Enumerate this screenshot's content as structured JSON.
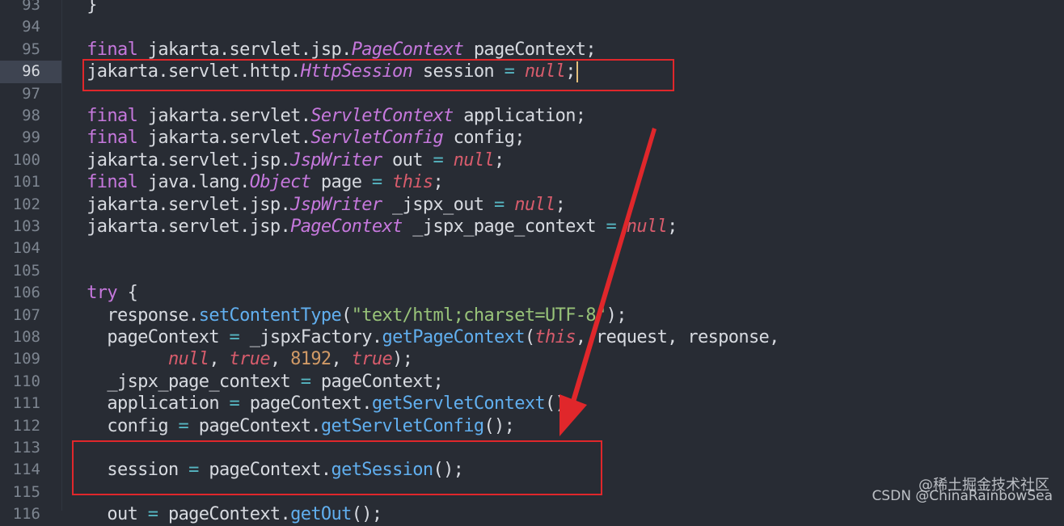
{
  "editor": {
    "active_line": "96",
    "line_numbers": [
      "93",
      "94",
      "95",
      "96",
      "97",
      "98",
      "99",
      "100",
      "101",
      "102",
      "103",
      "104",
      "105",
      "106",
      "107",
      "108",
      "109",
      "110",
      "111",
      "112",
      "113",
      "114",
      "115",
      "116"
    ],
    "lines": [
      [
        {
          "t": "  }",
          "c": "pl"
        }
      ],
      [],
      [
        {
          "t": "  ",
          "c": "pl"
        },
        {
          "t": "final",
          "c": "kw"
        },
        {
          "t": " jakarta.servlet.jsp.",
          "c": "pl"
        },
        {
          "t": "PageContext",
          "c": "cls"
        },
        {
          "t": " pageContext;",
          "c": "pl"
        }
      ],
      [
        {
          "t": "  jakarta.servlet.http.",
          "c": "pl"
        },
        {
          "t": "HttpSession",
          "c": "cls"
        },
        {
          "t": " session ",
          "c": "pl"
        },
        {
          "t": "=",
          "c": "op"
        },
        {
          "t": " ",
          "c": "pl"
        },
        {
          "t": "null",
          "c": "lit"
        },
        {
          "t": ";",
          "c": "pl"
        }
      ],
      [],
      [
        {
          "t": "  ",
          "c": "pl"
        },
        {
          "t": "final",
          "c": "kw"
        },
        {
          "t": " jakarta.servlet.",
          "c": "pl"
        },
        {
          "t": "ServletContext",
          "c": "cls"
        },
        {
          "t": " application;",
          "c": "pl"
        }
      ],
      [
        {
          "t": "  ",
          "c": "pl"
        },
        {
          "t": "final",
          "c": "kw"
        },
        {
          "t": " jakarta.servlet.",
          "c": "pl"
        },
        {
          "t": "ServletConfig",
          "c": "cls"
        },
        {
          "t": " config;",
          "c": "pl"
        }
      ],
      [
        {
          "t": "  jakarta.servlet.jsp.",
          "c": "pl"
        },
        {
          "t": "JspWriter",
          "c": "cls"
        },
        {
          "t": " out ",
          "c": "pl"
        },
        {
          "t": "=",
          "c": "op"
        },
        {
          "t": " ",
          "c": "pl"
        },
        {
          "t": "null",
          "c": "lit"
        },
        {
          "t": ";",
          "c": "pl"
        }
      ],
      [
        {
          "t": "  ",
          "c": "pl"
        },
        {
          "t": "final",
          "c": "kw"
        },
        {
          "t": " java.lang.",
          "c": "pl"
        },
        {
          "t": "Object",
          "c": "cls"
        },
        {
          "t": " page ",
          "c": "pl"
        },
        {
          "t": "=",
          "c": "op"
        },
        {
          "t": " ",
          "c": "pl"
        },
        {
          "t": "this",
          "c": "lit"
        },
        {
          "t": ";",
          "c": "pl"
        }
      ],
      [
        {
          "t": "  jakarta.servlet.jsp.",
          "c": "pl"
        },
        {
          "t": "JspWriter",
          "c": "cls"
        },
        {
          "t": " _jspx_out ",
          "c": "pl"
        },
        {
          "t": "=",
          "c": "op"
        },
        {
          "t": " ",
          "c": "pl"
        },
        {
          "t": "null",
          "c": "lit"
        },
        {
          "t": ";",
          "c": "pl"
        }
      ],
      [
        {
          "t": "  jakarta.servlet.jsp.",
          "c": "pl"
        },
        {
          "t": "PageContext",
          "c": "cls"
        },
        {
          "t": " _jspx_page_context ",
          "c": "pl"
        },
        {
          "t": "=",
          "c": "op"
        },
        {
          "t": " ",
          "c": "pl"
        },
        {
          "t": "null",
          "c": "lit"
        },
        {
          "t": ";",
          "c": "pl"
        }
      ],
      [],
      [],
      [
        {
          "t": "  ",
          "c": "pl"
        },
        {
          "t": "try",
          "c": "kw"
        },
        {
          "t": " {",
          "c": "pl"
        }
      ],
      [
        {
          "t": "    response.",
          "c": "pl"
        },
        {
          "t": "setContentType",
          "c": "fn"
        },
        {
          "t": "(",
          "c": "pl"
        },
        {
          "t": "\"text/html;charset=UTF-8\"",
          "c": "str"
        },
        {
          "t": ");",
          "c": "pl"
        }
      ],
      [
        {
          "t": "    pageContext ",
          "c": "pl"
        },
        {
          "t": "=",
          "c": "op"
        },
        {
          "t": " _jspxFactory.",
          "c": "pl"
        },
        {
          "t": "getPageContext",
          "c": "fn"
        },
        {
          "t": "(",
          "c": "pl"
        },
        {
          "t": "this",
          "c": "lit"
        },
        {
          "t": ", request, response,",
          "c": "pl"
        }
      ],
      [
        {
          "t": "          ",
          "c": "pl"
        },
        {
          "t": "null",
          "c": "lit"
        },
        {
          "t": ", ",
          "c": "pl"
        },
        {
          "t": "true",
          "c": "lit"
        },
        {
          "t": ", ",
          "c": "pl"
        },
        {
          "t": "8192",
          "c": "num"
        },
        {
          "t": ", ",
          "c": "pl"
        },
        {
          "t": "true",
          "c": "lit"
        },
        {
          "t": ");",
          "c": "pl"
        }
      ],
      [
        {
          "t": "    _jspx_page_context ",
          "c": "pl"
        },
        {
          "t": "=",
          "c": "op"
        },
        {
          "t": " pageContext;",
          "c": "pl"
        }
      ],
      [
        {
          "t": "    application ",
          "c": "pl"
        },
        {
          "t": "=",
          "c": "op"
        },
        {
          "t": " pageContext.",
          "c": "pl"
        },
        {
          "t": "getServletContext",
          "c": "fn"
        },
        {
          "t": "();",
          "c": "pl"
        }
      ],
      [
        {
          "t": "    config ",
          "c": "pl"
        },
        {
          "t": "=",
          "c": "op"
        },
        {
          "t": " pageContext.",
          "c": "pl"
        },
        {
          "t": "getServletConfig",
          "c": "fn"
        },
        {
          "t": "();",
          "c": "pl"
        }
      ],
      [],
      [
        {
          "t": "    session ",
          "c": "pl"
        },
        {
          "t": "=",
          "c": "op"
        },
        {
          "t": " pageContext.",
          "c": "pl"
        },
        {
          "t": "getSession",
          "c": "fn"
        },
        {
          "t": "();",
          "c": "pl"
        }
      ],
      [],
      [
        {
          "t": "    out ",
          "c": "pl"
        },
        {
          "t": "=",
          "c": "op"
        },
        {
          "t": " pageContext.",
          "c": "pl"
        },
        {
          "t": "getOut",
          "c": "fn"
        },
        {
          "t": "();",
          "c": "pl"
        }
      ]
    ]
  },
  "colors": {
    "background": "#282c34",
    "keyword": "#c678dd",
    "literal": "#d85c6c",
    "function": "#61afef",
    "string": "#98c379",
    "number": "#d19a66",
    "annotation": "#e0272b"
  },
  "annotations": {
    "boxes": [
      "line-96-highlight",
      "line-114-highlight"
    ],
    "arrow": "arrow-from-line-96-to-line-114"
  },
  "watermark": {
    "prefix": "CSDN @ChinaRainbowSea",
    "overlay": "@稀土掘金技术社区"
  }
}
